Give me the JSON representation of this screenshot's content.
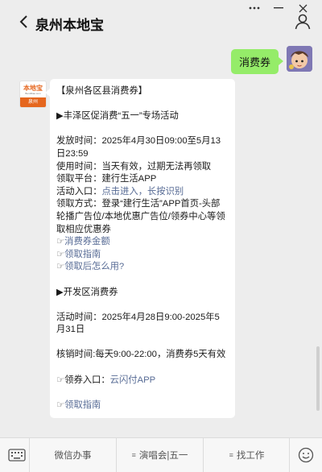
{
  "header": {
    "title": "泉州本地宝"
  },
  "sent_message": {
    "text": "消费券"
  },
  "bot_avatar": {
    "logo_cn": "本地宝",
    "logo_en": "Bendibao.com",
    "city": "泉州"
  },
  "message_lines": [
    {
      "text": "【泉州各区县消费券】"
    },
    {
      "text": ""
    },
    {
      "text": "▶丰泽区促消费“五一”专场活动"
    },
    {
      "text": ""
    },
    {
      "text": "发放时间：2025年4月30日09:00至5月13日23:59"
    },
    {
      "text": "使用时间：当天有效，过期无法再领取"
    },
    {
      "text": "领取平台：建行生活APP"
    },
    {
      "prefix": "活动入口：",
      "link": "点击进入，长按识别"
    },
    {
      "text": "领取方式：登录“建行生活”APP首页-头部轮播广告位/本地优惠广告位/领券中心等领取相应优惠券"
    },
    {
      "hand": "☞",
      "link": "消费券金额"
    },
    {
      "hand": "☞",
      "link": "领取指南"
    },
    {
      "hand": "☞",
      "link": "领取后怎么用?"
    },
    {
      "text": ""
    },
    {
      "text": "▶开发区消费券"
    },
    {
      "text": ""
    },
    {
      "text": "活动时间：2025年4月28日9:00-2025年5月31日"
    },
    {
      "text": ""
    },
    {
      "text": "核销时间:每天9:00-22:00，消费券5天有效"
    },
    {
      "text": ""
    },
    {
      "hand": "☞",
      "prefix": "领券入口：",
      "link": "云闪付APP"
    },
    {
      "text": ""
    },
    {
      "hand": "☞",
      "link": "领取指南"
    }
  ],
  "bottom_menu": {
    "items": [
      {
        "label": "微信办事",
        "glyph": ""
      },
      {
        "label": "演唱会|五一",
        "glyph": "≡"
      },
      {
        "label": "找工作",
        "glyph": "≡"
      }
    ]
  },
  "colors": {
    "link": "#576b95",
    "sent_bubble": "#95ec69",
    "brand_orange": "#e5661e"
  },
  "icons": {
    "back": "chevron-left-icon",
    "person": "person-icon",
    "keyboard": "keyboard-icon",
    "emoji": "emoji-icon"
  }
}
